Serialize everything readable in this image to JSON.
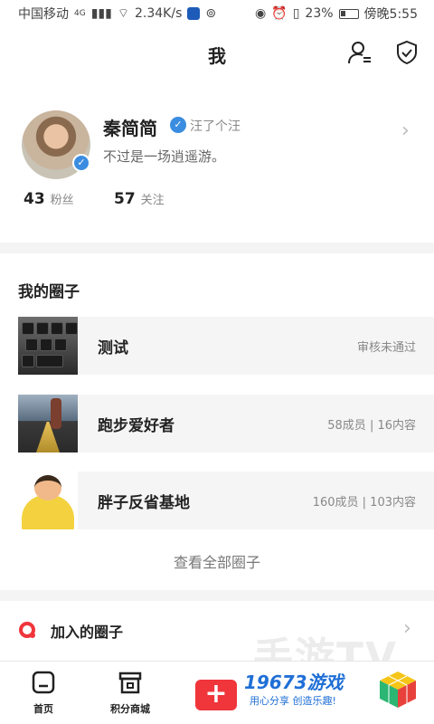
{
  "status_bar": {
    "carrier": "中国移动",
    "network": "4G",
    "speed": "2.34K/s",
    "battery": "23%",
    "time": "傍晚5:55"
  },
  "header": {
    "title": "我"
  },
  "profile": {
    "name": "秦简简",
    "verify_text": "汪了个汪",
    "bio": "不过是一场逍遥游。",
    "stats": [
      {
        "value": "43",
        "label": "粉丝"
      },
      {
        "value": "57",
        "label": "关注"
      }
    ]
  },
  "my_circles": {
    "title": "我的圈子",
    "items": [
      {
        "name": "测试",
        "meta": "审核未通过"
      },
      {
        "name": "跑步爱好者",
        "meta": "58成员 | 16内容"
      },
      {
        "name": "胖子反省基地",
        "meta": "160成员 | 103内容"
      }
    ],
    "view_all": "查看全部圈子"
  },
  "joined": {
    "label": "加入的圈子"
  },
  "tabbar": {
    "items": [
      {
        "label": "首页"
      },
      {
        "label": "积分商城"
      }
    ],
    "add": "+"
  },
  "watermark": {
    "bg_text": "手游TV",
    "brand": "19673游戏",
    "slogan": "用心分享 创造乐趣!"
  },
  "colors": {
    "accent": "#f0353b",
    "verify": "#3a8de0",
    "brand": "#1f6fd6"
  }
}
